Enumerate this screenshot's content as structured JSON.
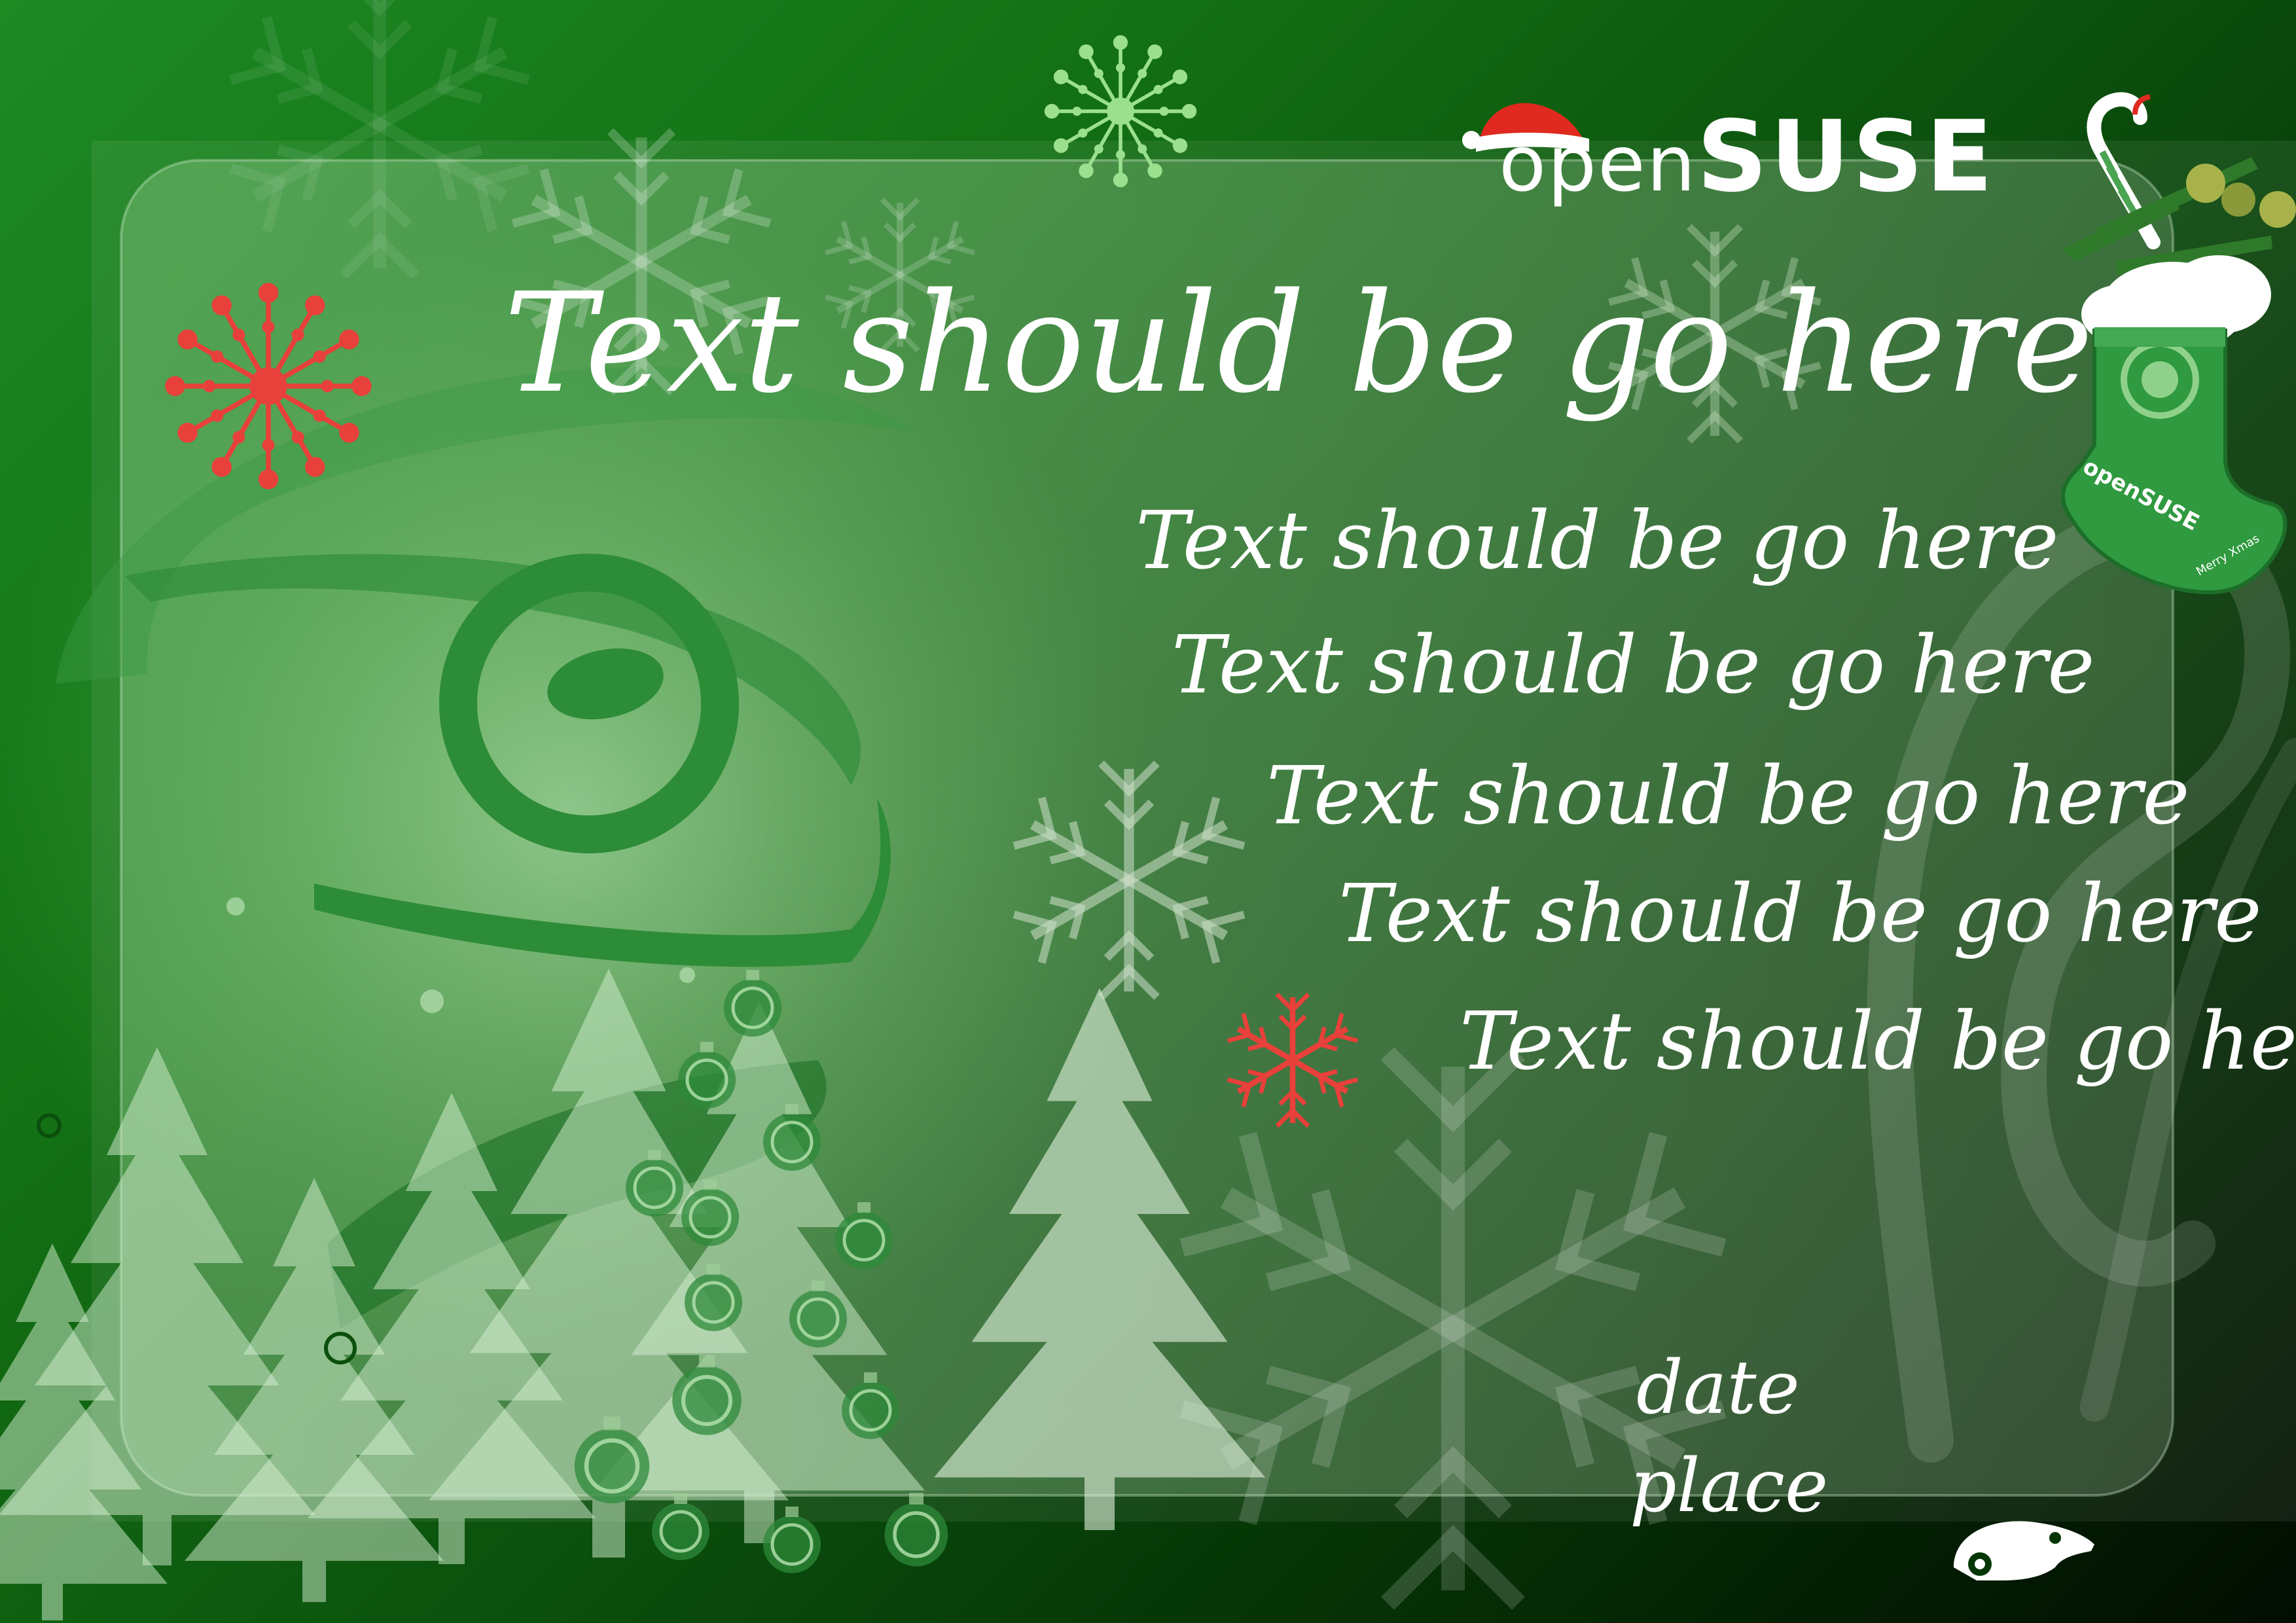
{
  "card": {
    "heading": "Text should be go here",
    "lines": [
      "Text should be go here",
      "Text should be go here",
      "Text should be go here",
      "Text should be go here",
      "Text should be go here"
    ],
    "date": "date",
    "place": "place"
  },
  "logo": {
    "prefix": "open",
    "brand": "SUSE"
  },
  "stocking": {
    "brand": "openSUSE",
    "greeting": "Merry Xmas"
  },
  "colors": {
    "background_light": "#1d8a24",
    "background_dark": "#020d02",
    "text": "#ffffff",
    "snowflake_red": "#e8403a",
    "snowflake_green": "#9be08f",
    "stocking": "#2f9a3f"
  },
  "icons": [
    "geeko-chameleon-icon",
    "snowflake-icon",
    "christmas-tree-icon",
    "santa-hat-icon",
    "candy-cane-icon",
    "christmas-stocking-icon",
    "ornament-ball-icon"
  ]
}
